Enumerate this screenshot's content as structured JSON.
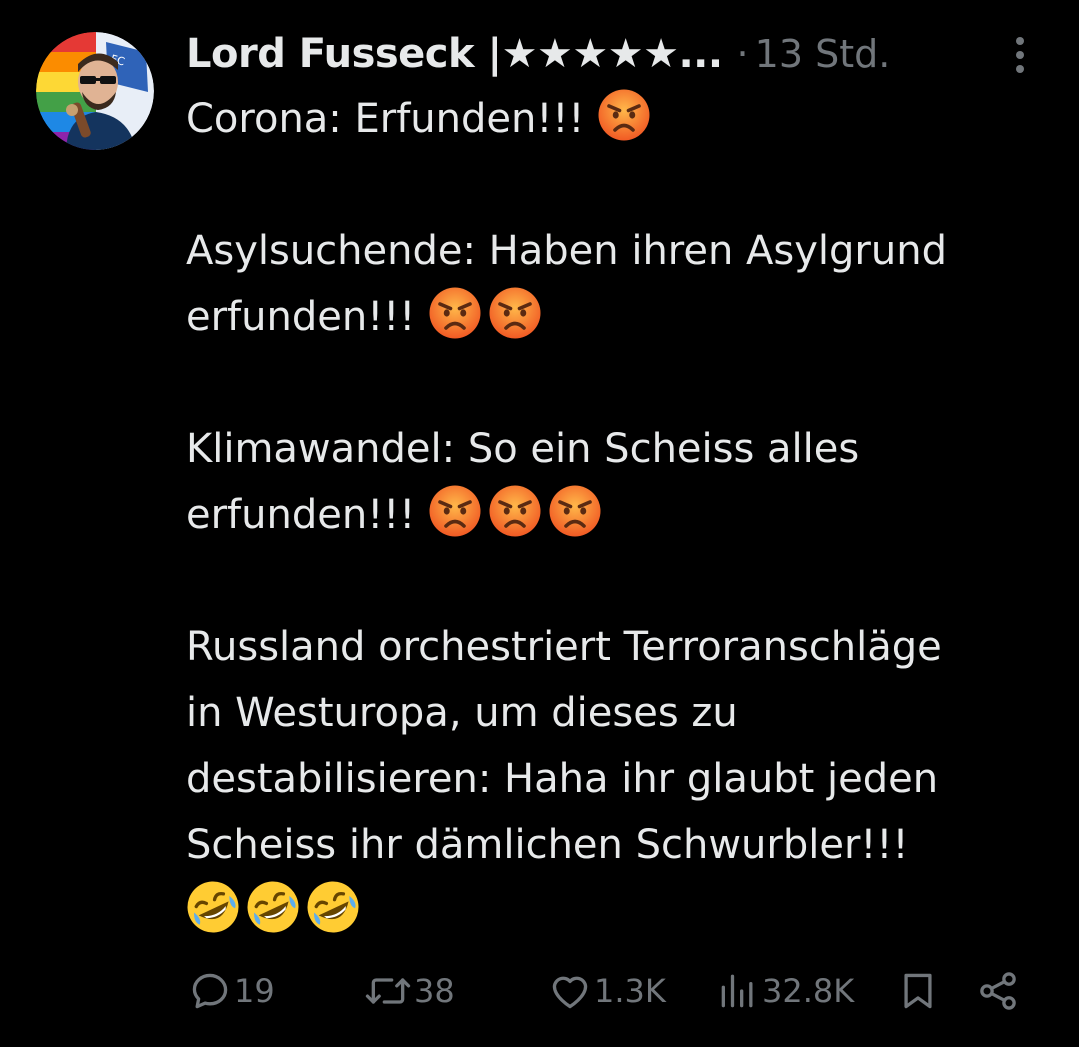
{
  "author": {
    "display_name": "Lord Fusseck |★★★★★...",
    "separator": "·",
    "timestamp": "13 Std."
  },
  "body": {
    "paragraphs": [
      {
        "lines": [
          {
            "text": "Corona: Erfunden!!! ",
            "emojis": [
              "angry-face"
            ]
          }
        ]
      },
      {
        "lines": [
          {
            "text": "Asylsuchende: Haben ihren Asylgrund",
            "emojis": []
          },
          {
            "text": "erfunden!!! ",
            "emojis": [
              "angry-face",
              "angry-face"
            ]
          }
        ]
      },
      {
        "lines": [
          {
            "text": "Klimawandel: So ein Scheiss alles",
            "emojis": []
          },
          {
            "text": "erfunden!!! ",
            "emojis": [
              "angry-face",
              "angry-face",
              "angry-face"
            ]
          }
        ]
      },
      {
        "lines": [
          {
            "text": "Russland orchestriert Terroranschläge",
            "emojis": []
          },
          {
            "text": "in Westuropa, um dieses zu",
            "emojis": []
          },
          {
            "text": "destabilisieren: Haha ihr glaubt jeden",
            "emojis": []
          },
          {
            "text": "Scheiss ihr dämlichen Schwurbler!!!",
            "emojis": []
          },
          {
            "text": "",
            "emojis": [
              "rolling-laughing-face",
              "rolling-laughing-face",
              "rolling-laughing-face"
            ]
          }
        ]
      }
    ]
  },
  "actions": {
    "replies": "19",
    "reposts": "38",
    "likes": "1.3K",
    "views": "32.8K"
  },
  "icons": {
    "reply": "speech-bubble-icon",
    "repost": "repost-arrows-icon",
    "like": "heart-icon",
    "views": "bar-chart-icon",
    "bookmark": "bookmark-icon",
    "share": "share-icon",
    "more": "more-vertical-icon"
  },
  "colors": {
    "background": "#000000",
    "text": "#e7e9ea",
    "secondary": "#71767b"
  }
}
